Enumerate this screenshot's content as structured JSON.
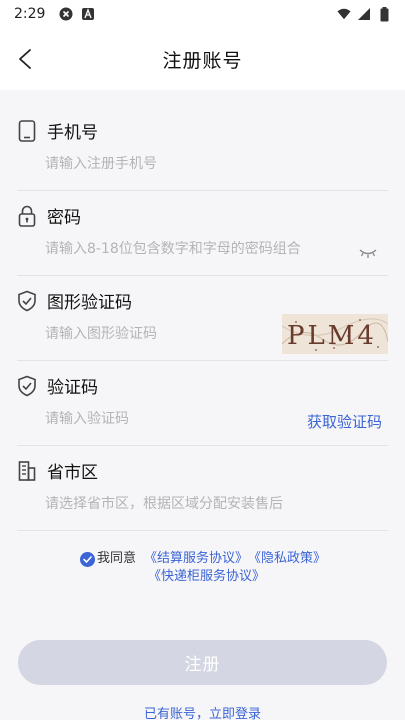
{
  "status_bar": {
    "time": "2:29",
    "icons_left": [
      "shield-x-icon",
      "font-a-icon"
    ],
    "icons_right": [
      "wifi-icon",
      "signal-icon",
      "battery-icon"
    ]
  },
  "nav": {
    "title": "注册账号",
    "back_icon": "chevron-left-icon"
  },
  "form": {
    "phone": {
      "label": "手机号",
      "placeholder": "请输入注册手机号",
      "icon": "phone-icon"
    },
    "password": {
      "label": "密码",
      "placeholder": "请输入8-18位包含数字和字母的密码组合",
      "icon": "lock-icon",
      "toggle_icon": "eye-closed-icon"
    },
    "captcha": {
      "label": "图形验证码",
      "placeholder": "请输入图形验证码",
      "icon": "shield-check-icon",
      "image_text": "PLM4"
    },
    "sms_code": {
      "label": "验证码",
      "placeholder": "请输入验证码",
      "icon": "shield-check-icon",
      "action_label": "获取验证码"
    },
    "region": {
      "label": "省市区",
      "placeholder": "请选择省市区，根据区域分配安装售后",
      "icon": "building-icon"
    }
  },
  "agreement": {
    "checked": true,
    "text": "我同意",
    "links": [
      "《结算服务协议》",
      "《隐私政策》",
      "《快递柜服务协议》"
    ]
  },
  "submit": {
    "label": "注册"
  },
  "footer": {
    "login_prompt": "已有账号，立即登录"
  },
  "colors": {
    "accent": "#3b64d6",
    "button_disabled": "#d4d6e3",
    "background": "#f6f6f8"
  }
}
